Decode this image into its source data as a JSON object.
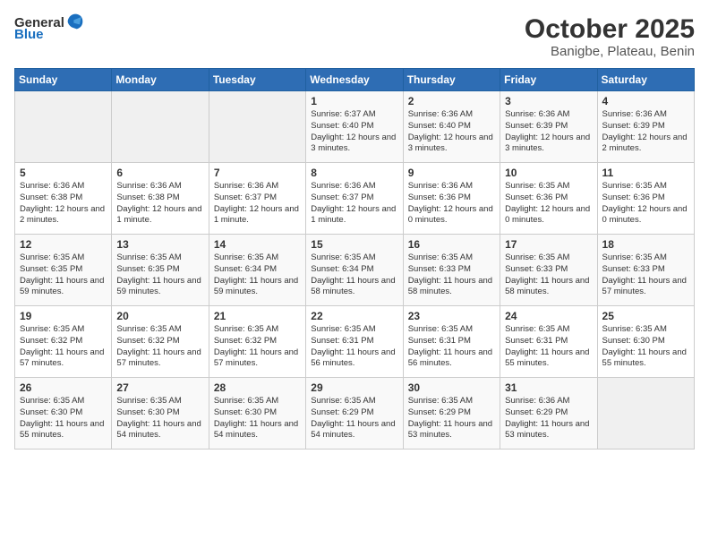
{
  "header": {
    "logo_general": "General",
    "logo_blue": "Blue",
    "title": "October 2025",
    "subtitle": "Banigbe, Plateau, Benin"
  },
  "weekdays": [
    "Sunday",
    "Monday",
    "Tuesday",
    "Wednesday",
    "Thursday",
    "Friday",
    "Saturday"
  ],
  "weeks": [
    [
      {
        "day": "",
        "info": ""
      },
      {
        "day": "",
        "info": ""
      },
      {
        "day": "",
        "info": ""
      },
      {
        "day": "1",
        "info": "Sunrise: 6:37 AM\nSunset: 6:40 PM\nDaylight: 12 hours and 3 minutes."
      },
      {
        "day": "2",
        "info": "Sunrise: 6:36 AM\nSunset: 6:40 PM\nDaylight: 12 hours and 3 minutes."
      },
      {
        "day": "3",
        "info": "Sunrise: 6:36 AM\nSunset: 6:39 PM\nDaylight: 12 hours and 3 minutes."
      },
      {
        "day": "4",
        "info": "Sunrise: 6:36 AM\nSunset: 6:39 PM\nDaylight: 12 hours and 2 minutes."
      }
    ],
    [
      {
        "day": "5",
        "info": "Sunrise: 6:36 AM\nSunset: 6:38 PM\nDaylight: 12 hours and 2 minutes."
      },
      {
        "day": "6",
        "info": "Sunrise: 6:36 AM\nSunset: 6:38 PM\nDaylight: 12 hours and 1 minute."
      },
      {
        "day": "7",
        "info": "Sunrise: 6:36 AM\nSunset: 6:37 PM\nDaylight: 12 hours and 1 minute."
      },
      {
        "day": "8",
        "info": "Sunrise: 6:36 AM\nSunset: 6:37 PM\nDaylight: 12 hours and 1 minute."
      },
      {
        "day": "9",
        "info": "Sunrise: 6:36 AM\nSunset: 6:36 PM\nDaylight: 12 hours and 0 minutes."
      },
      {
        "day": "10",
        "info": "Sunrise: 6:35 AM\nSunset: 6:36 PM\nDaylight: 12 hours and 0 minutes."
      },
      {
        "day": "11",
        "info": "Sunrise: 6:35 AM\nSunset: 6:36 PM\nDaylight: 12 hours and 0 minutes."
      }
    ],
    [
      {
        "day": "12",
        "info": "Sunrise: 6:35 AM\nSunset: 6:35 PM\nDaylight: 11 hours and 59 minutes."
      },
      {
        "day": "13",
        "info": "Sunrise: 6:35 AM\nSunset: 6:35 PM\nDaylight: 11 hours and 59 minutes."
      },
      {
        "day": "14",
        "info": "Sunrise: 6:35 AM\nSunset: 6:34 PM\nDaylight: 11 hours and 59 minutes."
      },
      {
        "day": "15",
        "info": "Sunrise: 6:35 AM\nSunset: 6:34 PM\nDaylight: 11 hours and 58 minutes."
      },
      {
        "day": "16",
        "info": "Sunrise: 6:35 AM\nSunset: 6:33 PM\nDaylight: 11 hours and 58 minutes."
      },
      {
        "day": "17",
        "info": "Sunrise: 6:35 AM\nSunset: 6:33 PM\nDaylight: 11 hours and 58 minutes."
      },
      {
        "day": "18",
        "info": "Sunrise: 6:35 AM\nSunset: 6:33 PM\nDaylight: 11 hours and 57 minutes."
      }
    ],
    [
      {
        "day": "19",
        "info": "Sunrise: 6:35 AM\nSunset: 6:32 PM\nDaylight: 11 hours and 57 minutes."
      },
      {
        "day": "20",
        "info": "Sunrise: 6:35 AM\nSunset: 6:32 PM\nDaylight: 11 hours and 57 minutes."
      },
      {
        "day": "21",
        "info": "Sunrise: 6:35 AM\nSunset: 6:32 PM\nDaylight: 11 hours and 57 minutes."
      },
      {
        "day": "22",
        "info": "Sunrise: 6:35 AM\nSunset: 6:31 PM\nDaylight: 11 hours and 56 minutes."
      },
      {
        "day": "23",
        "info": "Sunrise: 6:35 AM\nSunset: 6:31 PM\nDaylight: 11 hours and 56 minutes."
      },
      {
        "day": "24",
        "info": "Sunrise: 6:35 AM\nSunset: 6:31 PM\nDaylight: 11 hours and 55 minutes."
      },
      {
        "day": "25",
        "info": "Sunrise: 6:35 AM\nSunset: 6:30 PM\nDaylight: 11 hours and 55 minutes."
      }
    ],
    [
      {
        "day": "26",
        "info": "Sunrise: 6:35 AM\nSunset: 6:30 PM\nDaylight: 11 hours and 55 minutes."
      },
      {
        "day": "27",
        "info": "Sunrise: 6:35 AM\nSunset: 6:30 PM\nDaylight: 11 hours and 54 minutes."
      },
      {
        "day": "28",
        "info": "Sunrise: 6:35 AM\nSunset: 6:30 PM\nDaylight: 11 hours and 54 minutes."
      },
      {
        "day": "29",
        "info": "Sunrise: 6:35 AM\nSunset: 6:29 PM\nDaylight: 11 hours and 54 minutes."
      },
      {
        "day": "30",
        "info": "Sunrise: 6:35 AM\nSunset: 6:29 PM\nDaylight: 11 hours and 53 minutes."
      },
      {
        "day": "31",
        "info": "Sunrise: 6:36 AM\nSunset: 6:29 PM\nDaylight: 11 hours and 53 minutes."
      },
      {
        "day": "",
        "info": ""
      }
    ]
  ]
}
